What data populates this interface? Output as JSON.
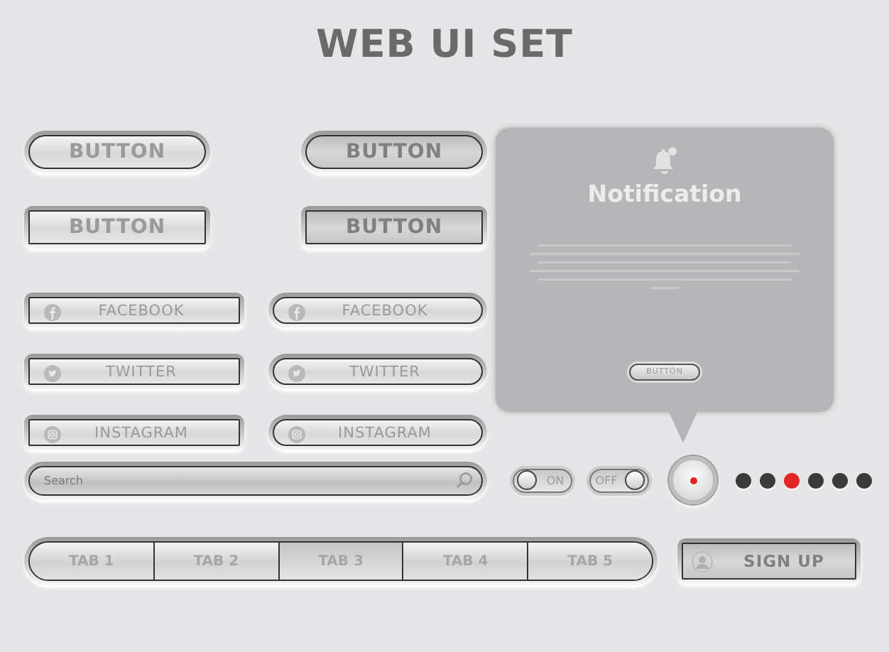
{
  "title": "WEB UI SET",
  "buttons": [
    {
      "label": "BUTTON",
      "kind": "pill",
      "pressed": false
    },
    {
      "label": "BUTTON",
      "kind": "pill",
      "pressed": true
    },
    {
      "label": "BUTTON",
      "kind": "rect",
      "pressed": false
    },
    {
      "label": "BUTTON",
      "kind": "rect",
      "pressed": true
    }
  ],
  "social_buttons": [
    {
      "label": "FACEBOOK",
      "kind": "rect"
    },
    {
      "label": "FACEBOOK",
      "kind": "pill"
    },
    {
      "label": "TWITTER",
      "kind": "rect"
    },
    {
      "label": "TWITTER",
      "kind": "pill"
    },
    {
      "label": "INSTAGRAM",
      "kind": "rect"
    },
    {
      "label": "INSTAGRAM",
      "kind": "pill"
    }
  ],
  "notification": {
    "title": "Notification",
    "button": "BUTTON"
  },
  "search": {
    "placeholder": "Search"
  },
  "toggles": [
    {
      "label": "ON",
      "on": false
    },
    {
      "label": "OFF",
      "on": true
    }
  ],
  "indicator_dots": [
    {
      "color": "#3a3a3a"
    },
    {
      "color": "#3a3a3a"
    },
    {
      "color": "#e02626"
    },
    {
      "color": "#3a3a3a"
    },
    {
      "color": "#3a3a3a"
    },
    {
      "color": "#3a3a3a"
    }
  ],
  "tabs": [
    {
      "label": "TAB 1",
      "selected": false
    },
    {
      "label": "TAB 2",
      "selected": false
    },
    {
      "label": "TAB 3",
      "selected": true
    },
    {
      "label": "TAB 4",
      "selected": false
    },
    {
      "label": "TAB 5",
      "selected": false
    }
  ],
  "sign_up": {
    "label": "SIGN UP"
  }
}
